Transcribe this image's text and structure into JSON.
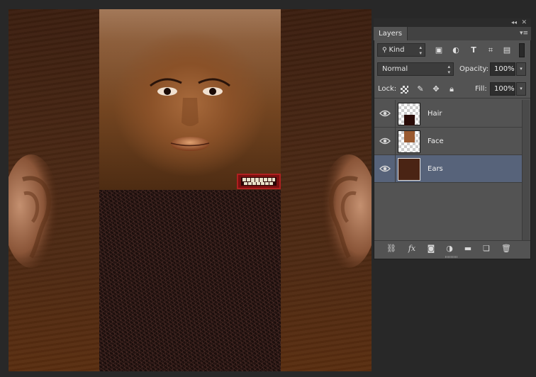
{
  "panel": {
    "tab_label": "Layers",
    "collapse_icon": "double-chevron-left-icon",
    "close_icon": "close-icon",
    "menu_icon": "panel-menu-icon"
  },
  "filter": {
    "kind_label": "Kind",
    "icons": [
      "pixel-filter-icon",
      "adjustment-filter-icon",
      "type-filter-icon",
      "shape-filter-icon",
      "smart-object-filter-icon",
      "filter-toggle-icon"
    ]
  },
  "blend": {
    "mode": "Normal",
    "opacity_label": "Opacity:",
    "opacity_value": "100%"
  },
  "lock": {
    "label": "Lock:",
    "icons": [
      "lock-transparent-pixels-icon",
      "lock-image-pixels-icon",
      "lock-position-icon",
      "lock-all-icon"
    ],
    "fill_label": "Fill:",
    "fill_value": "100%"
  },
  "layers": [
    {
      "name": "Hair",
      "visible": true,
      "selected": false
    },
    {
      "name": "Face",
      "visible": true,
      "selected": false
    },
    {
      "name": "Ears",
      "visible": true,
      "selected": true
    }
  ],
  "footer": {
    "fx_label": "fx",
    "icons": [
      "link-layers-icon",
      "layer-style-icon",
      "layer-mask-icon",
      "adjustment-layer-icon",
      "new-group-icon",
      "new-layer-icon",
      "delete-layer-icon"
    ]
  },
  "colors": {
    "workspace": "#282828",
    "panel": "#535353",
    "selected_layer": "#57637a"
  }
}
